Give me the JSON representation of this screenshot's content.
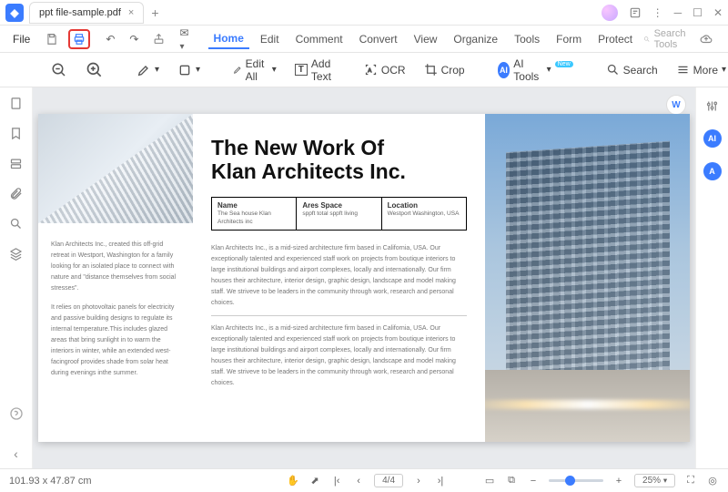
{
  "title_bar": {
    "tab_title": "ppt file-sample.pdf"
  },
  "menu": {
    "file": "File",
    "items": [
      "Home",
      "Edit",
      "Comment",
      "Convert",
      "View",
      "Organize",
      "Tools",
      "Form",
      "Protect"
    ],
    "search_tools": "Search Tools"
  },
  "toolbar": {
    "edit_all": "Edit All",
    "add_text": "Add Text",
    "ocr": "OCR",
    "crop": "Crop",
    "ai_tools": "AI Tools",
    "search": "Search",
    "more": "More"
  },
  "document": {
    "headline_l1": "The New Work Of",
    "headline_l2": "Klan Architects Inc.",
    "table": {
      "name_label": "Name",
      "name_value": "The Sea house Klan Architects inc",
      "area_label": "Ares Space",
      "area_value": "sppft total sppft living",
      "location_label": "Location",
      "location_value": "Westport Washington, USA"
    },
    "left_p1": "Klan Architects Inc., created this off-grid retreat in Westport, Washington for a family looking for an isolated place to connect with nature and \"distance themselves from social stresses\".",
    "left_p2": "It relies on photovoltaic panels for electricity and passive building designs to regulate its internal temperature.This includes glazed areas that bring sunlight in to warm the interiors in winter, while an extended west-facingroof provides shade from solar heat during evenings inthe summer.",
    "body_p1": "Klan Architects Inc., is a mid-sized architecture firm based in California, USA. Our exceptionally talented and experienced staff work on projects from boutique interiors to large institutional buildings and airport complexes, locally and internationally. Our firm houses their architecture, interior design, graphic design, landscape and model making staff. We striveve to be leaders in the community through work, research and personal choices.",
    "body_p2": "Klan Architects Inc., is a mid-sized architecture firm based in California, USA. Our exceptionally talented and experienced staff work on projects from boutique interiors to large institutional buildings and airport complexes, locally and internationally. Our firm houses their architecture, interior design, graphic design, landscape and model making staff. We striveve to be leaders in the community through work, research and personal choices."
  },
  "status": {
    "dimensions": "101.93 x 47.87 cm",
    "page_current": "4",
    "page_total": "/4",
    "zoom": "25%"
  }
}
